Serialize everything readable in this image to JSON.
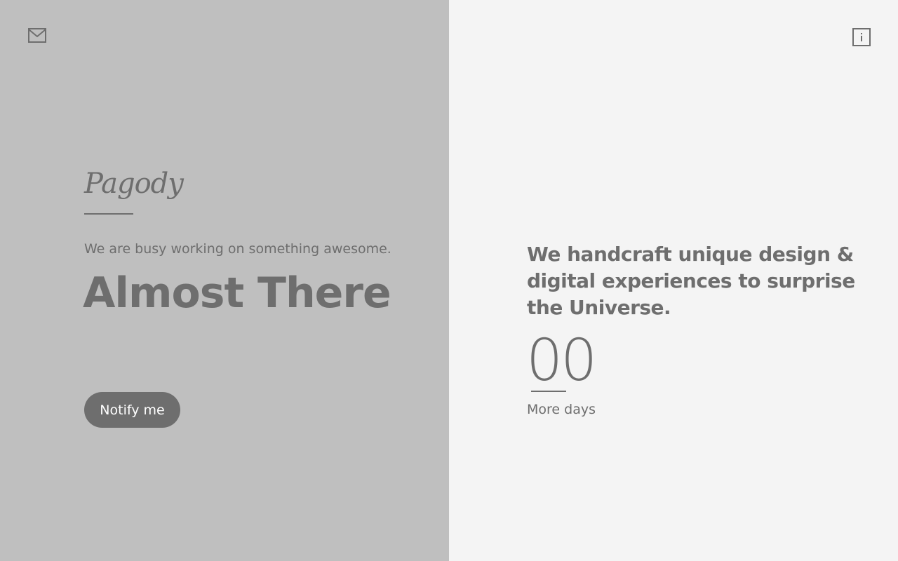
{
  "colors": {
    "left_panel_bg": "#bfbfbf",
    "right_panel_bg": "#f4f4f4",
    "text": "#6e6e6e",
    "button_text": "#ffffff"
  },
  "header": {
    "left_icon": "mail-icon",
    "right_icon": "info-icon"
  },
  "hero": {
    "logo": "Pagody",
    "tagline": "We are busy working on something awesome.",
    "headline": "Almost There",
    "notify_label": "Notify me"
  },
  "about": {
    "headline": "We handcraft unique design & digital experiences to surprise the Universe."
  },
  "countdown": {
    "value": "00",
    "label": "More days"
  }
}
